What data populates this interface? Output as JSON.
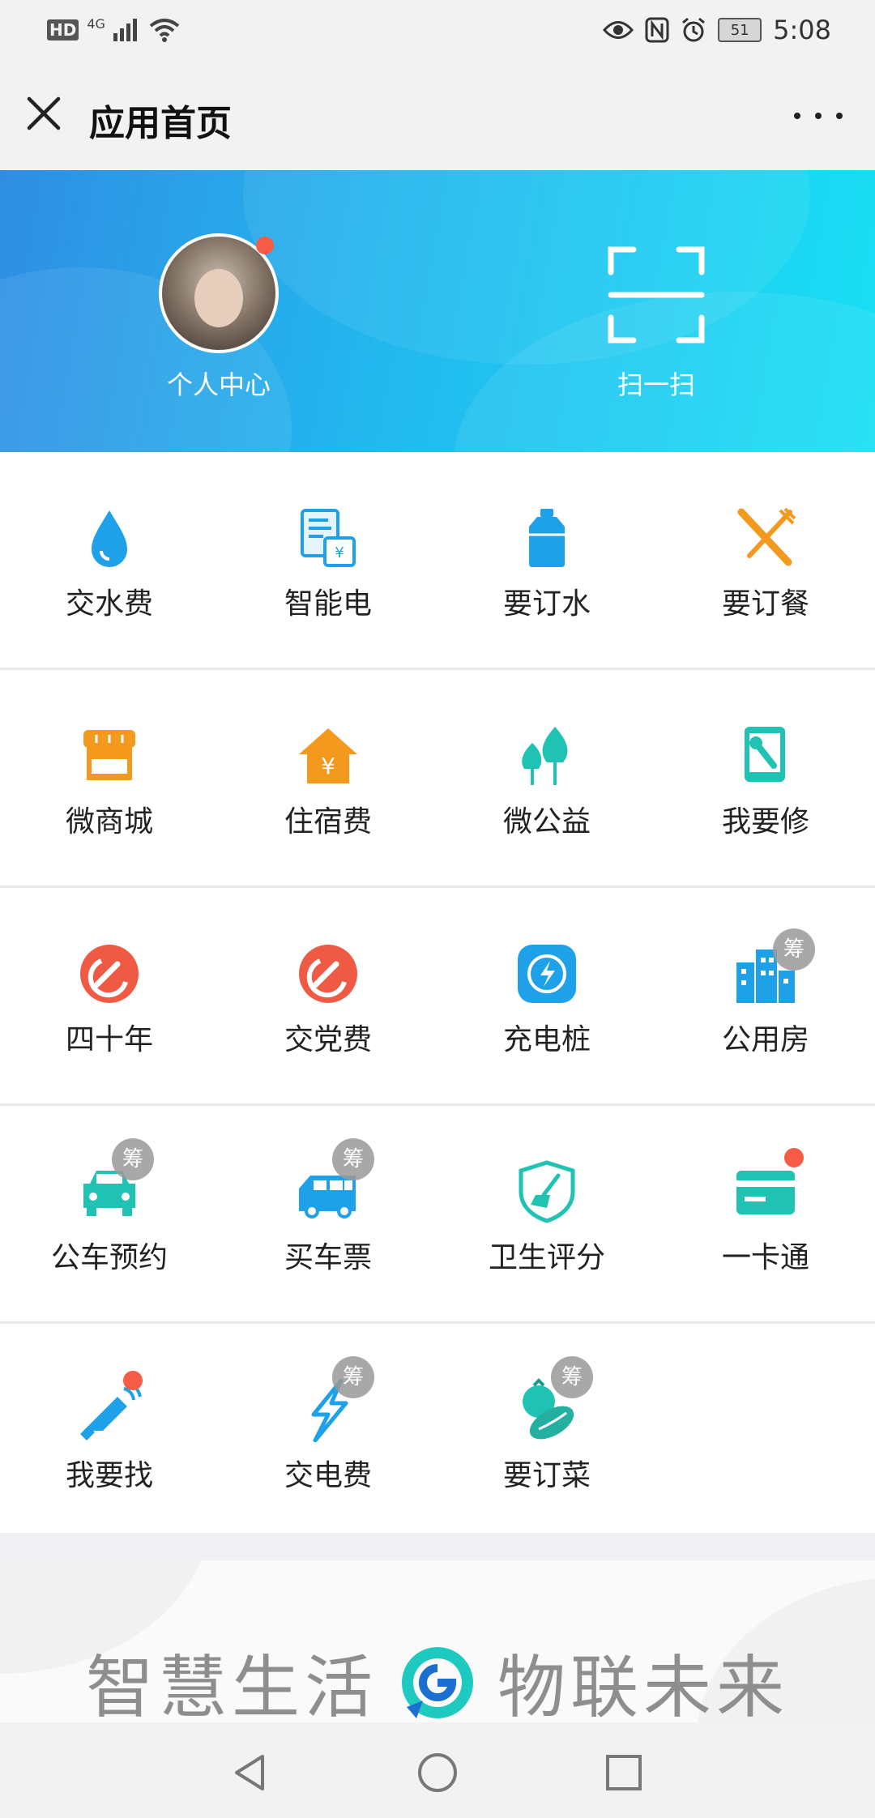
{
  "status_bar": {
    "left_badges": [
      "HD",
      "4G"
    ],
    "time": "5:08",
    "battery_level": "51",
    "icons": [
      "hd-icon",
      "signal-icon",
      "wifi-icon",
      "eye-icon",
      "nfc-icon",
      "alarm-icon",
      "battery-icon"
    ]
  },
  "header": {
    "title": "应用首页",
    "close_icon": "close-icon",
    "more_icon": "more-icon"
  },
  "banner": {
    "profile_label": "个人中心",
    "scan_label": "扫一扫",
    "colors": {
      "gradient_start": "#2f8ee3",
      "gradient_end": "#18e0f4"
    }
  },
  "apps": {
    "rows": [
      [
        {
          "label": "交水费",
          "icon": "water-drop-icon",
          "color": "#1ea1e8"
        },
        {
          "label": "智能电",
          "icon": "bill-icon",
          "color": "#1ea1e8"
        },
        {
          "label": "要订水",
          "icon": "water-bottle-icon",
          "color": "#1ea1e8"
        },
        {
          "label": "要订餐",
          "icon": "utensils-icon",
          "color": "#f39a1e"
        }
      ],
      [
        {
          "label": "微商城",
          "icon": "shop-icon",
          "color": "#f39a1e"
        },
        {
          "label": "住宿费",
          "icon": "house-yen-icon",
          "color": "#f39a1e"
        },
        {
          "label": "微公益",
          "icon": "trees-icon",
          "color": "#20c3b3"
        },
        {
          "label": "我要修",
          "icon": "repair-icon",
          "color": "#20c3b3"
        }
      ],
      [
        {
          "label": "四十年",
          "icon": "party-emblem-icon",
          "color": "#ef5a44"
        },
        {
          "label": "交党费",
          "icon": "party-emblem-icon",
          "color": "#ef5a44"
        },
        {
          "label": "充电桩",
          "icon": "charging-icon",
          "color": "#1ea1e8"
        },
        {
          "label": "公用房",
          "icon": "building-icon",
          "color": "#1ea1e8",
          "badge": "筹"
        }
      ],
      [
        {
          "label": "公车预约",
          "icon": "car-icon",
          "color": "#20c3b3",
          "badge": "筹"
        },
        {
          "label": "买车票",
          "icon": "van-icon",
          "color": "#1ea1e8",
          "badge": "筹"
        },
        {
          "label": "卫生评分",
          "icon": "shield-broom-icon",
          "color": "#20c3b3"
        },
        {
          "label": "一卡通",
          "icon": "card-icon",
          "color": "#20c3b3",
          "dot": true
        }
      ],
      [
        {
          "label": "我要找",
          "icon": "megaphone-icon",
          "color": "#1ea1e8",
          "dot": true
        },
        {
          "label": "交电费",
          "icon": "lightning-icon",
          "color": "#1ea1e8",
          "badge": "筹"
        },
        {
          "label": "要订菜",
          "icon": "vegetable-icon",
          "color": "#20c3b3",
          "badge": "筹"
        }
      ]
    ]
  },
  "footer": {
    "slogan_left": "智慧生活",
    "slogan_right": "物联未来"
  },
  "navbar": {
    "icons": [
      "back-icon",
      "home-icon",
      "recents-icon"
    ]
  }
}
